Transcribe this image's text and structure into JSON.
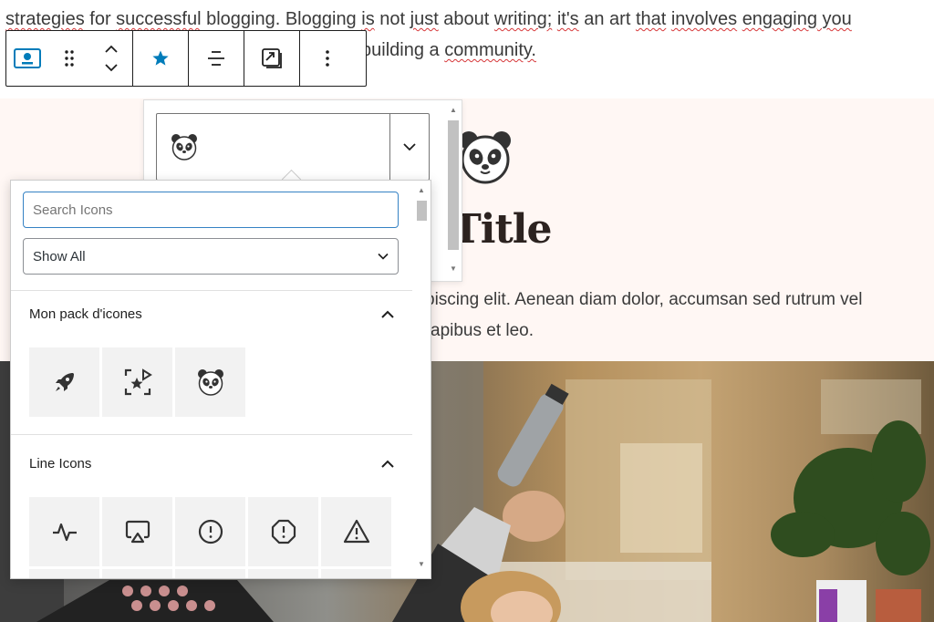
{
  "editor": {
    "para_line1_a": "strategies",
    "para_line1_b": " for ",
    "para_line1_c": "successful",
    "para_line1_d": " blogging. Blogging ",
    "para_line1_e": "is",
    "para_line1_f": " not ",
    "para_line1_g": "just",
    "para_line1_h": " about ",
    "para_line1_i": "writing;",
    "para_line1_j": " ",
    "para_line1_k": "it's",
    "para_line1_l": " an art ",
    "para_line1_m": "that",
    "para_line1_n": " ",
    "para_line1_o": "involves",
    "para_line1_p": " ",
    "para_line1_q": "engaging",
    "para_line1_r": " you",
    "para_line2_a": "building a ",
    "para_line2_b": "community.",
    "heading_partial": "Title",
    "body_line1": "piscing elit. Aenean diam dolor, accumsan sed rutrum vel",
    "body_line2": "apibus et leo."
  },
  "toolbar": {
    "block_icon": "image-block-icon",
    "drag_icon": "drag-handle-icon",
    "move_up_icon": "chevron-up-icon",
    "move_down_icon": "chevron-down-icon",
    "icon_picker_icon": "star-icon",
    "align_icon": "align-center-icon",
    "replace_icon": "replace-media-icon",
    "more_icon": "more-vertical-icon",
    "accent": "#007cba"
  },
  "icon_picker": {
    "selected_icon": "panda-icon",
    "search_placeholder": "Search Icons",
    "search_value": "",
    "filter_value": "Show All",
    "sections": [
      {
        "title": "Mon pack d'icones",
        "icons": [
          "rocket-icon",
          "star-scan-icon",
          "panda-icon"
        ]
      },
      {
        "title": "Line Icons",
        "icons": [
          "activity-icon",
          "airplay-icon",
          "alert-circle-icon",
          "alert-octagon-icon",
          "alert-triangle-icon"
        ]
      }
    ]
  },
  "colors": {
    "section_bg": "#fff7f4",
    "focus_border": "#3582c4",
    "spellcheck": "#d63638"
  }
}
